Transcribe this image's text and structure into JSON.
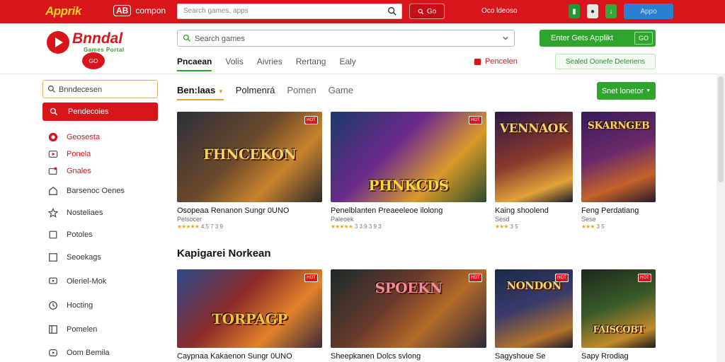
{
  "topbar": {
    "logo": "Apprik",
    "brand_badge": "AB",
    "brand_text": "compon",
    "search_placeholder": "Search games, apps",
    "button_label": "Go",
    "user_label": "Oco ldeoso",
    "app_badge": "Appo"
  },
  "brand": {
    "title": "Bnndal",
    "subtitle": "Games Portal",
    "badge": "GO"
  },
  "main_search": {
    "placeholder": "Search games"
  },
  "green_button": {
    "label": "Enter Gets Applikt",
    "sub": "GO"
  },
  "nav": {
    "tabs": [
      {
        "label": "Pncaean",
        "active": true
      },
      {
        "label": "Volis"
      },
      {
        "label": "Aivries"
      },
      {
        "label": "Rertang"
      },
      {
        "label": "Ealy"
      }
    ],
    "red_link": "Pencelen",
    "green_link": "Sealed Oonefe Deteriens"
  },
  "sidebar": {
    "search_placeholder": "Bnndecesen",
    "active": "Pendecoies",
    "items": [
      {
        "label": "Geosesta",
        "icon": "circle-icon",
        "color": "red"
      },
      {
        "label": "Ponela",
        "icon": "play-icon",
        "color": "red"
      },
      {
        "label": "Gnales",
        "icon": "gamepad-icon",
        "color": "red"
      },
      {
        "label": "Barsenoc Oenes",
        "icon": "home-icon"
      },
      {
        "label": "Nosteliaes",
        "icon": "star-icon"
      },
      {
        "label": "Potoles",
        "icon": "tablet-icon"
      },
      {
        "label": "Seoekags",
        "icon": "square-icon"
      },
      {
        "label": "Oleriel-Mok",
        "icon": "chat-icon"
      },
      {
        "label": "Hocting",
        "icon": "clock-icon"
      },
      {
        "label": "Pomelen",
        "icon": "grid-icon"
      },
      {
        "label": "Oom Bemila",
        "icon": "play-circle-icon"
      }
    ]
  },
  "categories": {
    "tabs": [
      "Ben:laas",
      "Polmenrá",
      "Pomen",
      "Game"
    ],
    "filter_button": "Snet lonetor"
  },
  "row1": [
    {
      "art": "FHNCEKON",
      "name": "Osopeaa Renanon Sungr 0UNO",
      "meta": "Pelsocer",
      "rating_text": "4.5 7 3 9"
    },
    {
      "art": "PHNKCDS",
      "name": "Penelblanten Preaeeleoe ilolong",
      "meta": "Paleoek",
      "rating_text": "3 3.9 3 9 3"
    },
    {
      "art": "VENNAOK",
      "name": "Kaing shoolend",
      "meta": "Sesd",
      "rating_text": "3 5"
    },
    {
      "art": "SKARNGEB",
      "name": "Feng Perdatiang",
      "meta": "Sese",
      "rating_text": "3 5"
    }
  ],
  "section2_title": "Kapigarei Norkean",
  "row2": [
    {
      "art": "TORPAGP",
      "name": "Caypnaa Kakaenon Sungr 0UNO"
    },
    {
      "art": "SPOEKN",
      "name": "Sheepkanen Dolcs svlong"
    },
    {
      "art": "NONDON",
      "name": "Sagyshoue Se"
    },
    {
      "art": "FAISCOBT",
      "name": "Sapy Rrodiag"
    }
  ]
}
